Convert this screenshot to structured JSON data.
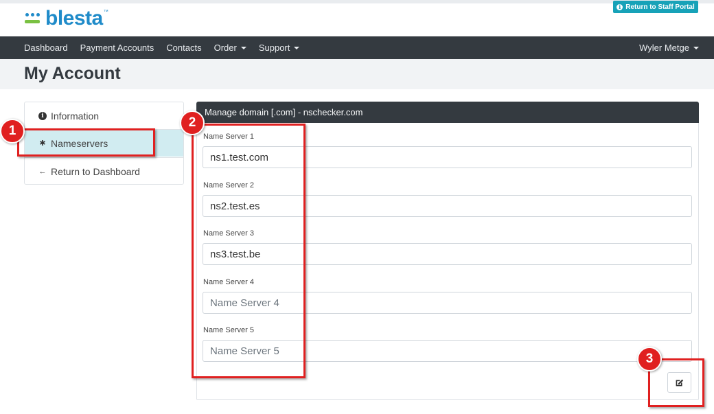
{
  "header": {
    "logo_text": "blesta",
    "logo_tm": "™",
    "staff_portal_label": "Return to Staff Portal",
    "brand_color": "#1f8bc9"
  },
  "nav": {
    "items": [
      "Dashboard",
      "Payment Accounts",
      "Contacts",
      "Order",
      "Support"
    ],
    "user": "Wyler Metge"
  },
  "page": {
    "title": "My Account"
  },
  "sidebar": {
    "items": [
      {
        "label": "Information",
        "icon": "info-circle-icon"
      },
      {
        "label": "Nameservers",
        "icon": "gear-icon",
        "active": true
      },
      {
        "label": "Return to Dashboard",
        "icon": "arrow-left-icon"
      }
    ]
  },
  "panel": {
    "title": "Manage domain [.com] - nschecker.com",
    "fields": [
      {
        "label": "Name Server 1",
        "value": "ns1.test.com",
        "placeholder": "Name Server 1"
      },
      {
        "label": "Name Server 2",
        "value": "ns2.test.es",
        "placeholder": "Name Server 2"
      },
      {
        "label": "Name Server 3",
        "value": "ns3.test.be",
        "placeholder": "Name Server 3"
      },
      {
        "label": "Name Server 4",
        "value": "",
        "placeholder": "Name Server 4"
      },
      {
        "label": "Name Server 5",
        "value": "",
        "placeholder": "Name Server 5"
      }
    ],
    "edit_icon": "edit-icon"
  },
  "annotations": {
    "steps": [
      "1",
      "2",
      "3"
    ],
    "color": "#e02020"
  }
}
